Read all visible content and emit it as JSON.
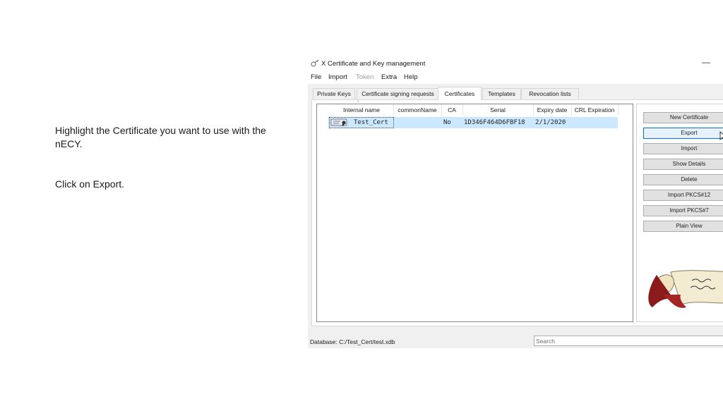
{
  "instructions": {
    "line1": "Highlight the Certificate you want to use with the nECY.",
    "line2": "Click on Export."
  },
  "window": {
    "title": "X Certificate and Key management",
    "minimize": "—"
  },
  "menu": {
    "file": "File",
    "import": "Import",
    "token": "Token",
    "extra": "Extra",
    "help": "Help"
  },
  "tabs": [
    "Private Keys",
    "Certificate signing requests",
    "Certificates",
    "Templates",
    "Revocation lists"
  ],
  "active_tab": "Certificates",
  "table": {
    "columns": [
      "Internal name",
      "commonName",
      "CA",
      "Serial",
      "Expiry date",
      "CRL Expiration"
    ],
    "rows": [
      {
        "internal_name": "Test_Cert",
        "common_name": "",
        "ca": "No",
        "serial": "1D346F464D6FBF18",
        "expiry": "2/1/2020",
        "crl": ""
      }
    ]
  },
  "buttons": {
    "new_certificate": "New Certificate",
    "export": "Export",
    "import": "Import",
    "show_details": "Show Details",
    "delete": "Delete",
    "import_pkcs12": "Import PKCS#12",
    "import_pkcs7": "Import PKCS#7",
    "plain_view": "Plain View"
  },
  "status": {
    "database": "Database: C:/Test_Cert/test.xdb",
    "search_placeholder": "Search"
  },
  "colors": {
    "selection": "#cce8ff",
    "focus_border": "#0078d7",
    "scroll_red": "#8b1a1a"
  },
  "icons": [
    "certificate-icon",
    "app-icon",
    "mouse-cursor-icon",
    "xca-scroll-logo"
  ]
}
